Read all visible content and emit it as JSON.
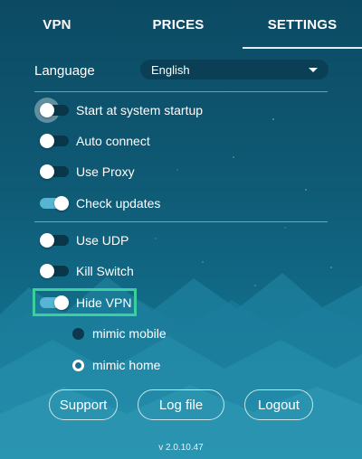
{
  "tabs": [
    {
      "label": "VPN"
    },
    {
      "label": "PRICES"
    },
    {
      "label": "SETTINGS",
      "active": true
    }
  ],
  "language": {
    "label": "Language",
    "value": "English"
  },
  "toggles": [
    {
      "label": "Start at system startup",
      "on": false,
      "focused": true
    },
    {
      "label": "Auto connect",
      "on": false
    },
    {
      "label": "Use Proxy",
      "on": false
    },
    {
      "label": "Check updates",
      "on": true
    },
    {
      "label": "Use UDP",
      "on": false
    },
    {
      "label": "Kill Switch",
      "on": false
    },
    {
      "label": "Hide VPN",
      "on": true,
      "highlighted": true
    }
  ],
  "radios": [
    {
      "label": "mimic mobile",
      "checked": false
    },
    {
      "label": "mimic home",
      "checked": true
    }
  ],
  "buttons": {
    "support": "Support",
    "logfile": "Log file",
    "logout": "Logout"
  },
  "version": "v 2.0.10.47",
  "colors": {
    "background_top": "#0c4a63",
    "background_bottom": "#1a8aa6",
    "toggle_on": "#56b5d2",
    "toggle_off": "#0a3649",
    "highlight": "#3bcf9e"
  }
}
